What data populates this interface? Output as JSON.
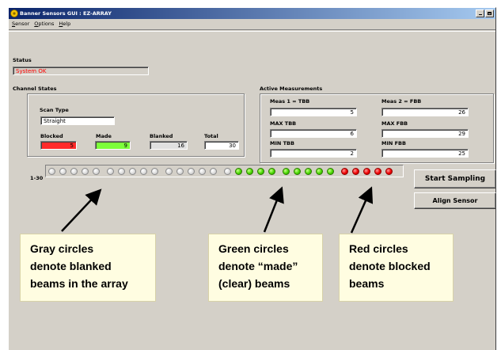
{
  "window": {
    "title": "Banner Sensors GUI : EZ-ARRAY",
    "menu": [
      "Sensor",
      "Options",
      "Help"
    ]
  },
  "status": {
    "label": "Status",
    "value": "System OK",
    "value_color": "#ff0000"
  },
  "channel_states": {
    "label": "Channel States",
    "scan_type_label": "Scan Type",
    "scan_type_value": "Straight",
    "blocked_label": "Blocked",
    "blocked_value": "5",
    "made_label": "Made",
    "made_value": "9",
    "blanked_label": "Blanked",
    "blanked_value": "16",
    "total_label": "Total",
    "total_value": "30"
  },
  "active_measurements": {
    "label": "Active Measurements",
    "meas1_label": "Meas 1 = TBB",
    "meas1_value": "5",
    "meas2_label": "Meas 2 = FBB",
    "meas2_value": "26",
    "max_tbb_label": "MAX TBB",
    "max_tbb_value": "6",
    "max_fbb_label": "MAX FBB",
    "max_fbb_value": "29",
    "min_tbb_label": "MIN TBB",
    "min_tbb_value": "2",
    "min_fbb_label": "MIN FBB",
    "min_fbb_value": "25"
  },
  "beams": {
    "range_label": "1-30",
    "states": [
      "blanked",
      "blanked",
      "blanked",
      "blanked",
      "blanked",
      "blanked",
      "blanked",
      "blanked",
      "blanked",
      "blanked",
      "blanked",
      "blanked",
      "blanked",
      "blanked",
      "blanked",
      "blanked",
      "made",
      "made",
      "made",
      "made",
      "made",
      "made",
      "made",
      "made",
      "made",
      "blocked",
      "blocked",
      "blocked",
      "blocked",
      "blocked"
    ],
    "colors": {
      "blanked": "#d8d8d8",
      "made": "#48d800",
      "blocked": "#f00000"
    }
  },
  "buttons": {
    "start_sampling": "Start Sampling",
    "align_sensor": "Align Sensor"
  },
  "callouts": {
    "gray": [
      "Gray circles",
      "denote blanked",
      "beams in the array"
    ],
    "green": [
      "Green circles",
      "denote “made”",
      "(clear) beams"
    ],
    "red": [
      "Red circles",
      "denote blocked",
      "beams"
    ]
  }
}
